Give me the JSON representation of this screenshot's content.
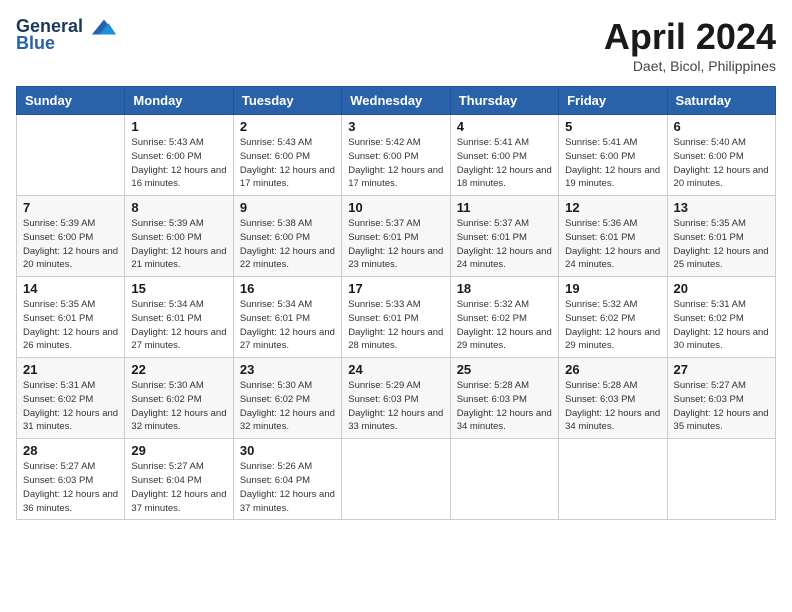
{
  "logo": {
    "general": "General",
    "blue": "Blue"
  },
  "title": "April 2024",
  "location": "Daet, Bicol, Philippines",
  "weekdays": [
    "Sunday",
    "Monday",
    "Tuesday",
    "Wednesday",
    "Thursday",
    "Friday",
    "Saturday"
  ],
  "weeks": [
    [
      {
        "day": null
      },
      {
        "day": 1,
        "sunrise": "5:43 AM",
        "sunset": "6:00 PM",
        "daylight": "12 hours and 16 minutes."
      },
      {
        "day": 2,
        "sunrise": "5:43 AM",
        "sunset": "6:00 PM",
        "daylight": "12 hours and 17 minutes."
      },
      {
        "day": 3,
        "sunrise": "5:42 AM",
        "sunset": "6:00 PM",
        "daylight": "12 hours and 17 minutes."
      },
      {
        "day": 4,
        "sunrise": "5:41 AM",
        "sunset": "6:00 PM",
        "daylight": "12 hours and 18 minutes."
      },
      {
        "day": 5,
        "sunrise": "5:41 AM",
        "sunset": "6:00 PM",
        "daylight": "12 hours and 19 minutes."
      },
      {
        "day": 6,
        "sunrise": "5:40 AM",
        "sunset": "6:00 PM",
        "daylight": "12 hours and 20 minutes."
      }
    ],
    [
      {
        "day": 7,
        "sunrise": "5:39 AM",
        "sunset": "6:00 PM",
        "daylight": "12 hours and 20 minutes."
      },
      {
        "day": 8,
        "sunrise": "5:39 AM",
        "sunset": "6:00 PM",
        "daylight": "12 hours and 21 minutes."
      },
      {
        "day": 9,
        "sunrise": "5:38 AM",
        "sunset": "6:00 PM",
        "daylight": "12 hours and 22 minutes."
      },
      {
        "day": 10,
        "sunrise": "5:37 AM",
        "sunset": "6:01 PM",
        "daylight": "12 hours and 23 minutes."
      },
      {
        "day": 11,
        "sunrise": "5:37 AM",
        "sunset": "6:01 PM",
        "daylight": "12 hours and 24 minutes."
      },
      {
        "day": 12,
        "sunrise": "5:36 AM",
        "sunset": "6:01 PM",
        "daylight": "12 hours and 24 minutes."
      },
      {
        "day": 13,
        "sunrise": "5:35 AM",
        "sunset": "6:01 PM",
        "daylight": "12 hours and 25 minutes."
      }
    ],
    [
      {
        "day": 14,
        "sunrise": "5:35 AM",
        "sunset": "6:01 PM",
        "daylight": "12 hours and 26 minutes."
      },
      {
        "day": 15,
        "sunrise": "5:34 AM",
        "sunset": "6:01 PM",
        "daylight": "12 hours and 27 minutes."
      },
      {
        "day": 16,
        "sunrise": "5:34 AM",
        "sunset": "6:01 PM",
        "daylight": "12 hours and 27 minutes."
      },
      {
        "day": 17,
        "sunrise": "5:33 AM",
        "sunset": "6:01 PM",
        "daylight": "12 hours and 28 minutes."
      },
      {
        "day": 18,
        "sunrise": "5:32 AM",
        "sunset": "6:02 PM",
        "daylight": "12 hours and 29 minutes."
      },
      {
        "day": 19,
        "sunrise": "5:32 AM",
        "sunset": "6:02 PM",
        "daylight": "12 hours and 29 minutes."
      },
      {
        "day": 20,
        "sunrise": "5:31 AM",
        "sunset": "6:02 PM",
        "daylight": "12 hours and 30 minutes."
      }
    ],
    [
      {
        "day": 21,
        "sunrise": "5:31 AM",
        "sunset": "6:02 PM",
        "daylight": "12 hours and 31 minutes."
      },
      {
        "day": 22,
        "sunrise": "5:30 AM",
        "sunset": "6:02 PM",
        "daylight": "12 hours and 32 minutes."
      },
      {
        "day": 23,
        "sunrise": "5:30 AM",
        "sunset": "6:02 PM",
        "daylight": "12 hours and 32 minutes."
      },
      {
        "day": 24,
        "sunrise": "5:29 AM",
        "sunset": "6:03 PM",
        "daylight": "12 hours and 33 minutes."
      },
      {
        "day": 25,
        "sunrise": "5:28 AM",
        "sunset": "6:03 PM",
        "daylight": "12 hours and 34 minutes."
      },
      {
        "day": 26,
        "sunrise": "5:28 AM",
        "sunset": "6:03 PM",
        "daylight": "12 hours and 34 minutes."
      },
      {
        "day": 27,
        "sunrise": "5:27 AM",
        "sunset": "6:03 PM",
        "daylight": "12 hours and 35 minutes."
      }
    ],
    [
      {
        "day": 28,
        "sunrise": "5:27 AM",
        "sunset": "6:03 PM",
        "daylight": "12 hours and 36 minutes."
      },
      {
        "day": 29,
        "sunrise": "5:27 AM",
        "sunset": "6:04 PM",
        "daylight": "12 hours and 37 minutes."
      },
      {
        "day": 30,
        "sunrise": "5:26 AM",
        "sunset": "6:04 PM",
        "daylight": "12 hours and 37 minutes."
      },
      {
        "day": null
      },
      {
        "day": null
      },
      {
        "day": null
      },
      {
        "day": null
      }
    ]
  ]
}
